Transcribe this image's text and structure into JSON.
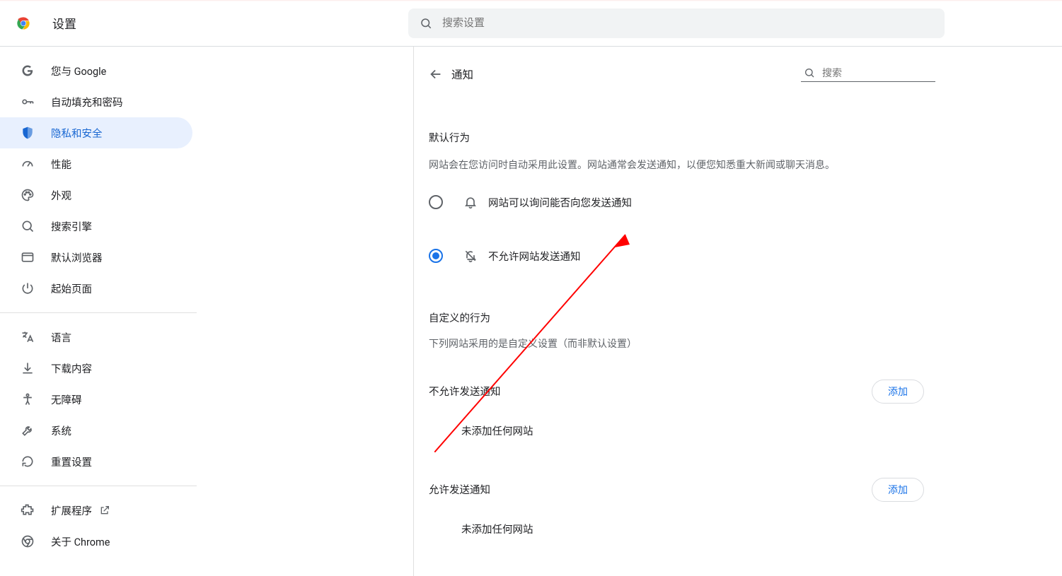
{
  "header": {
    "app_title": "设置",
    "search_placeholder": "搜索设置"
  },
  "sidebar": {
    "items": [
      {
        "label": "您与 Google"
      },
      {
        "label": "自动填充和密码"
      },
      {
        "label": "隐私和安全"
      },
      {
        "label": "性能"
      },
      {
        "label": "外观"
      },
      {
        "label": "搜索引擎"
      },
      {
        "label": "默认浏览器"
      },
      {
        "label": "起始页面"
      }
    ],
    "items2": [
      {
        "label": "语言"
      },
      {
        "label": "下载内容"
      },
      {
        "label": "无障碍"
      },
      {
        "label": "系统"
      },
      {
        "label": "重置设置"
      }
    ],
    "items3": [
      {
        "label": "扩展程序"
      },
      {
        "label": "关于 Chrome"
      }
    ]
  },
  "content": {
    "title": "通知",
    "search_placeholder": "搜索",
    "default": {
      "title": "默认行为",
      "desc": "网站会在您访问时自动采用此设置。网站通常会发送通知，以便您知悉重大新闻或聊天消息。",
      "opt_ask": "网站可以询问能否向您发送通知",
      "opt_block": "不允许网站发送通知"
    },
    "custom": {
      "title": "自定义的行为",
      "desc": "下列网站采用的是自定义设置（而非默认设置）"
    },
    "block": {
      "title": "不允许发送通知",
      "add": "添加",
      "empty": "未添加任何网站"
    },
    "allow": {
      "title": "允许发送通知",
      "add": "添加",
      "empty": "未添加任何网站"
    }
  }
}
